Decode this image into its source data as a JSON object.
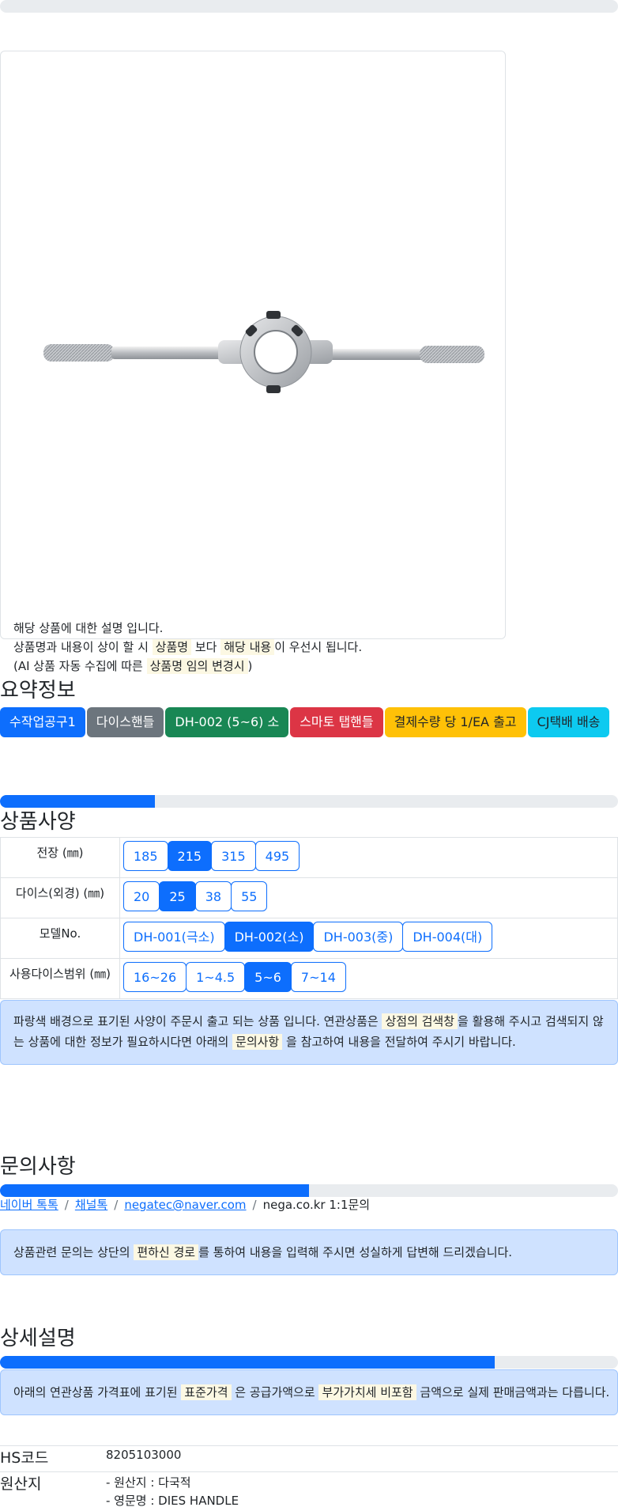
{
  "card": {
    "desc_line1": "해당 상품에 대한 설명 입니다.",
    "desc_line2_a": "상품명과 내용이 상이 할 시",
    "desc_line2_mark1": "상품명",
    "desc_line2_b": "보다",
    "desc_line2_mark2": "해당 내용",
    "desc_line2_c": "이 우선시 됩니다.",
    "desc_line3_a": "(AI 상품 자동 수집에 따른",
    "desc_line3_mark": "상품명 임의 변경시",
    "desc_line3_b": ")"
  },
  "summary": {
    "title": "요약정보",
    "badges": [
      {
        "label": "수작업공구1",
        "color": "#0d6efd"
      },
      {
        "label": "다이스핸들",
        "color": "#6c757d"
      },
      {
        "label": "DH-002 (5~6) 소",
        "color": "#198754"
      },
      {
        "label": "스마토 탭핸들",
        "color": "#dc3545"
      },
      {
        "label": "결제수량 당 1/EA 출고",
        "color": "#ffc107"
      },
      {
        "label": "CJ택배 배송",
        "color": "#0dcaf0"
      }
    ]
  },
  "spec": {
    "title": "상품사양",
    "progress_percent": 25,
    "rows": [
      {
        "label": "전장 (㎜)",
        "options": [
          "185",
          "215",
          "315",
          "495"
        ],
        "selected": 1
      },
      {
        "label": "다이스(외경) (㎜)",
        "options": [
          "20",
          "25",
          "38",
          "55"
        ],
        "selected": 1
      },
      {
        "label": "모델No.",
        "options": [
          "DH-001(극소)",
          "DH-002(소)",
          "DH-003(중)",
          "DH-004(대)"
        ],
        "selected": 1
      },
      {
        "label": "사용다이스범위 (㎜)",
        "options": [
          "16~26",
          "1~4.5",
          "5~6",
          "7~14"
        ],
        "selected": 2
      }
    ],
    "notice_line1_a": "파랑색 배경으로 표기된 사양이 주문시 출고 되는 상품 입니다. 연관상품은",
    "notice_line1_mark": "상점의 검색창",
    "notice_line1_b": "을 활용해 주시고 검색되지 않",
    "notice_line2_a": "는 상품에 대한 정보가 필요하시다면 아래의",
    "notice_line2_mark": "문의사항",
    "notice_line2_b": "을 참고하여 내용을 전달하여 주시기 바랍니다."
  },
  "inquiry": {
    "title": "문의사항",
    "progress_percent": 50,
    "links": [
      "네이버 톡톡",
      "채널톡",
      "negatec@naver.com"
    ],
    "last": "nega.co.kr 1:1문의",
    "notice_a": "상품관련 문의는 상단의",
    "notice_mark": "편하신 경로",
    "notice_b": "를 통하여 내용을 입력해 주시면 성실하게 답변해 드리겠습니다."
  },
  "detail": {
    "title": "상세설명",
    "progress_percent": 80,
    "notice_a": "아래의 연관상품 가격표에 표기된",
    "notice_mark1": "표준가격",
    "notice_b": "은 공급가액으로",
    "notice_mark2": "부가가치세 비포함",
    "notice_c": "금액으로 실제 판매금액과는 다릅니다.",
    "hs_label": "HS코드",
    "hs_value": "8205103000",
    "origin_label": "원산지",
    "origin_line1": "- 원산지 : 다국적",
    "origin_line2": "- 영문명 : DIES HANDLE"
  }
}
